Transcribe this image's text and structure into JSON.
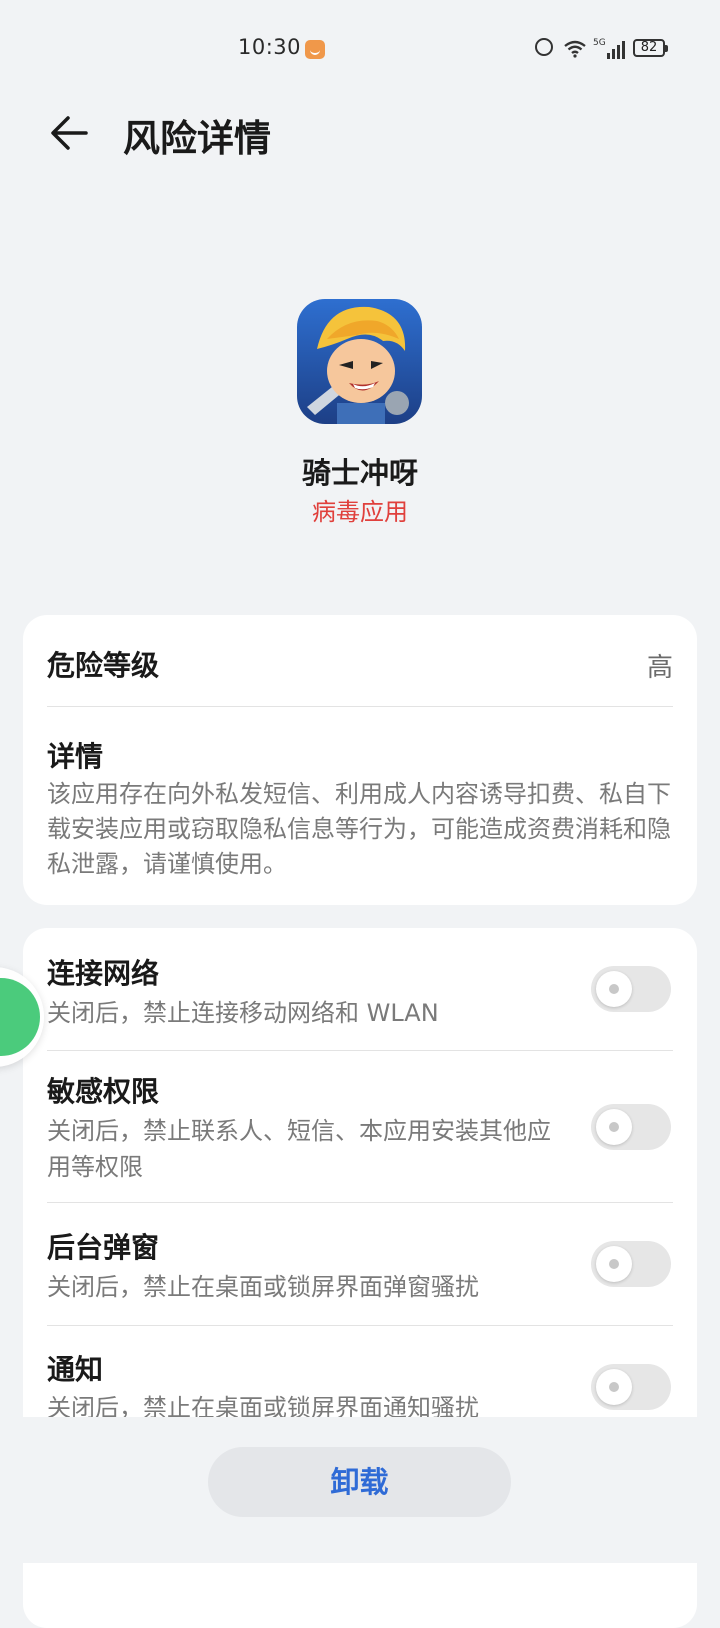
{
  "status_bar": {
    "time": "10:30",
    "network": "5G",
    "battery": "82",
    "icons": [
      "app-badge-icon",
      "alarm-icon",
      "wifi-icon",
      "signal-icon",
      "battery-icon"
    ]
  },
  "header": {
    "title": "风险详情",
    "back_icon": "arrow-left-icon"
  },
  "app": {
    "name": "骑士冲呀",
    "status": "病毒应用"
  },
  "risk_card": {
    "level_label": "危险等级",
    "level_value": "高",
    "details_label": "详情",
    "details_text": "该应用存在向外私发短信、利用成人内容诱导扣费、私自下载安装应用或窃取隐私信息等行为，可能造成资费消耗和隐私泄露，请谨慎使用。"
  },
  "permissions": [
    {
      "title": "连接网络",
      "desc": "关闭后，禁止连接移动网络和 WLAN",
      "enabled": false
    },
    {
      "title": "敏感权限",
      "desc": "关闭后，禁止联系人、短信、本应用安装其他应用等权限",
      "enabled": false
    },
    {
      "title": "后台弹窗",
      "desc": "关闭后，禁止在桌面或锁屏界面弹窗骚扰",
      "enabled": false
    },
    {
      "title": "通知",
      "desc": "关闭后，禁止在桌面或锁屏界面通知骚扰",
      "enabled": false
    }
  ],
  "bottom": {
    "uninstall_label": "卸载"
  },
  "colors": {
    "background": "#f1f3f5",
    "danger": "#e0403c",
    "accent": "#2f6bd6",
    "floating_bubble": "#2bc265"
  }
}
